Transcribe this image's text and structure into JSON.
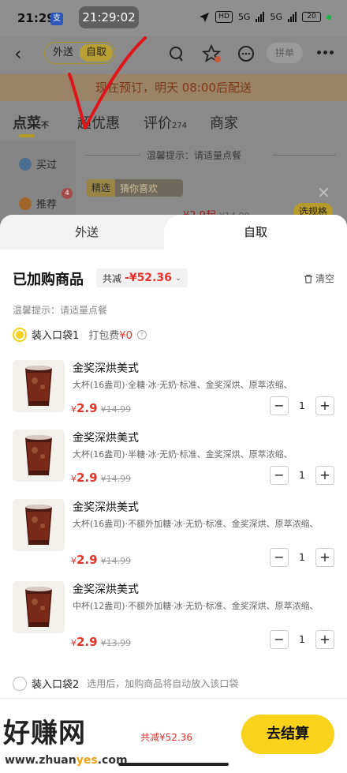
{
  "status_bar": {
    "time": "21:29",
    "app_badge": "支",
    "clock_overlay": "21:29:02",
    "hd": "HD",
    "net1": "5G",
    "net2": "5G",
    "battery": "20"
  },
  "nav": {
    "mode_delivery": "外送",
    "mode_pickup": "自取",
    "group_order": "拼单"
  },
  "banner": {
    "text": "现在预订，明天 08:00后配送"
  },
  "store_tabs": {
    "order": "点菜",
    "order_sup": "不",
    "deals": "超优惠",
    "reviews": "评价",
    "reviews_count": "274",
    "merchant": "商家"
  },
  "sidebar_bg": {
    "bought": "买过",
    "recommend": "推荐",
    "recommend_badge": "4"
  },
  "bg_content": {
    "tip": "温馨提示：请适量点餐",
    "featured_tag": "精选",
    "guess_tag": "猜你喜欢",
    "price": "¥2.9起",
    "orig_price": "¥14.99",
    "spec_button": "选规格"
  },
  "sheet": {
    "tab_delivery": "外送",
    "tab_pickup": "自取",
    "title": "已加购商品",
    "discount_label": "共减",
    "discount_amount": "-¥52.36",
    "clear_label": "清空",
    "tip": "温馨提示：请适量点餐",
    "bag1_label": "装入口袋1",
    "bag1_fee_label": "打包费",
    "bag1_fee": "¥0",
    "items": [
      {
        "name": "金奖深烘美式",
        "desc": "大杯(16盎司)·全糖·冰·无奶·标准、金奖深烘、原萃浓缩、",
        "price_symbol": "¥",
        "price": "2.9",
        "orig": "¥14.99",
        "qty": "1"
      },
      {
        "name": "金奖深烘美式",
        "desc": "大杯(16盎司)·半糖·冰·无奶·标准、金奖深烘、原萃浓缩、",
        "price_symbol": "¥",
        "price": "2.9",
        "orig": "¥14.99",
        "qty": "1"
      },
      {
        "name": "金奖深烘美式",
        "desc": "大杯(16盎司)·不额外加糖·冰·无奶·标准、金奖深烘、原萃浓缩、",
        "price_symbol": "¥",
        "price": "2.9",
        "orig": "¥14.99",
        "qty": "1"
      },
      {
        "name": "金奖深烘美式",
        "desc": "中杯(12盎司)·不额外加糖·冰·无奶·标准、金奖深烘、原萃浓缩、",
        "price_symbol": "¥",
        "price": "2.9",
        "orig": "¥13.99",
        "qty": "1"
      }
    ],
    "bag2_label": "装入口袋2",
    "bag2_hint": "选用后，加购商品将自动放入该口袋"
  },
  "bottom_bar": {
    "saved": "共减¥52.36",
    "checkout": "去结算",
    "watermark_logo": "好赚网",
    "watermark_url_prefix": "www.zhuan",
    "watermark_url_accent": "yes",
    "watermark_url_suffix": ".com"
  },
  "colors": {
    "accent_yellow": "#f9d21c",
    "price_red": "#e8322b",
    "annotation_red": "#e0151c"
  }
}
